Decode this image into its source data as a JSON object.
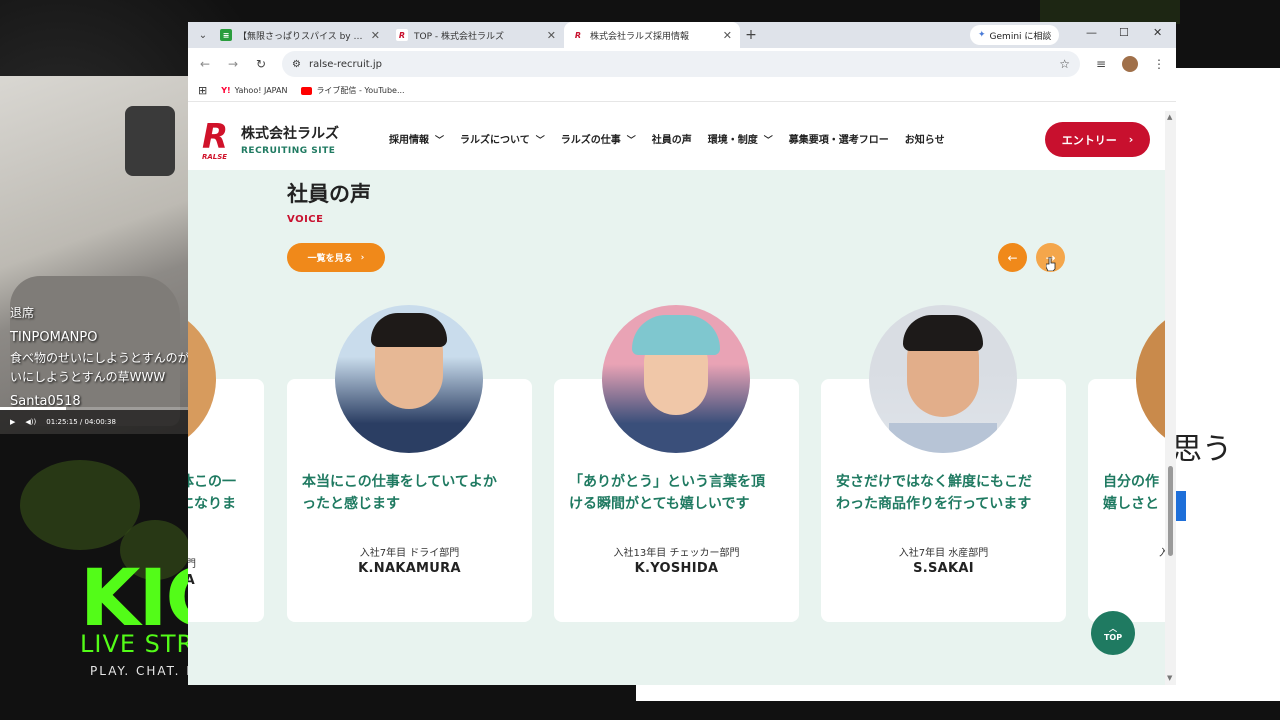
{
  "stream": {
    "chat": [
      {
        "text": "退席"
      },
      {
        "text": "TINPOMANPO"
      },
      {
        "text": "食べ物のせいにしようとすんのが"
      },
      {
        "text": "いにしようとすんの草WWW"
      },
      {
        "text": "Santa0518"
      }
    ],
    "player_time": "01:25:15 / 04:00:38",
    "player_progress": 0.35,
    "brand": {
      "logo": "KIC",
      "subtitle": "LIVE STREA",
      "tagline": "PLAY. CHAT. EA"
    },
    "side_text": "思う",
    "colors": {
      "kick_green": "#53fc18"
    }
  },
  "browser": {
    "tabs": [
      {
        "title": "【無限さっぱりスパイス by 味ぽん】ギ",
        "fav": "green",
        "active": false
      },
      {
        "title": "TOP - 株式会社ラルズ",
        "fav": "ralse",
        "active": false
      },
      {
        "title": "株式会社ラルズ採用情報",
        "fav": "ralse",
        "active": true
      }
    ],
    "gemini_label": "Gemini に相談",
    "url": "ralse-recruit.jp",
    "bookmarks": [
      {
        "label": "Yahoo! JAPAN"
      },
      {
        "label": "ライブ配信 - YouTube..."
      }
    ]
  },
  "site": {
    "company": "株式会社ラルズ",
    "recruiting": "RECRUITING SITE",
    "logo_sub": "RALSE",
    "nav": [
      {
        "label": "採用情報",
        "chevron": true
      },
      {
        "label": "ラルズについて",
        "chevron": true
      },
      {
        "label": "ラルズの仕事",
        "chevron": true
      },
      {
        "label": "社員の声",
        "chevron": false
      },
      {
        "label": "環境・制度",
        "chevron": true
      },
      {
        "label": "募集要項・選考フロー",
        "chevron": false
      },
      {
        "label": "お知らせ",
        "chevron": false
      }
    ],
    "entry_label": "エントリー",
    "section_title": "社員の声",
    "section_sub": "VOICE",
    "view_all": "一覧を見る",
    "top_label": "TOP",
    "colors": {
      "red": "#c8102e",
      "green": "#1f7a61",
      "orange": "#f0891a",
      "bg": "#e8f3ef"
    }
  },
  "cards": [
    {
      "title": "体この一\nになりま",
      "dept": "門",
      "name": "A"
    },
    {
      "title": "本当にこの仕事をしていてよか\nったと感じます",
      "dept": "入社7年目 ドライ部門",
      "name": "K.NAKAMURA"
    },
    {
      "title": "「ありがとう」という言葉を頂\nける瞬間がとても嬉しいです",
      "dept": "入社13年目 チェッカー部門",
      "name": "K.YOSHIDA"
    },
    {
      "title": "安さだけではなく鮮度にもこだ\nわった商品作りを行っています",
      "dept": "入社7年目 水産部門",
      "name": "S.SAKAI"
    },
    {
      "title": "自分の作\n嬉しさと",
      "dept": "入",
      "name": ""
    }
  ]
}
